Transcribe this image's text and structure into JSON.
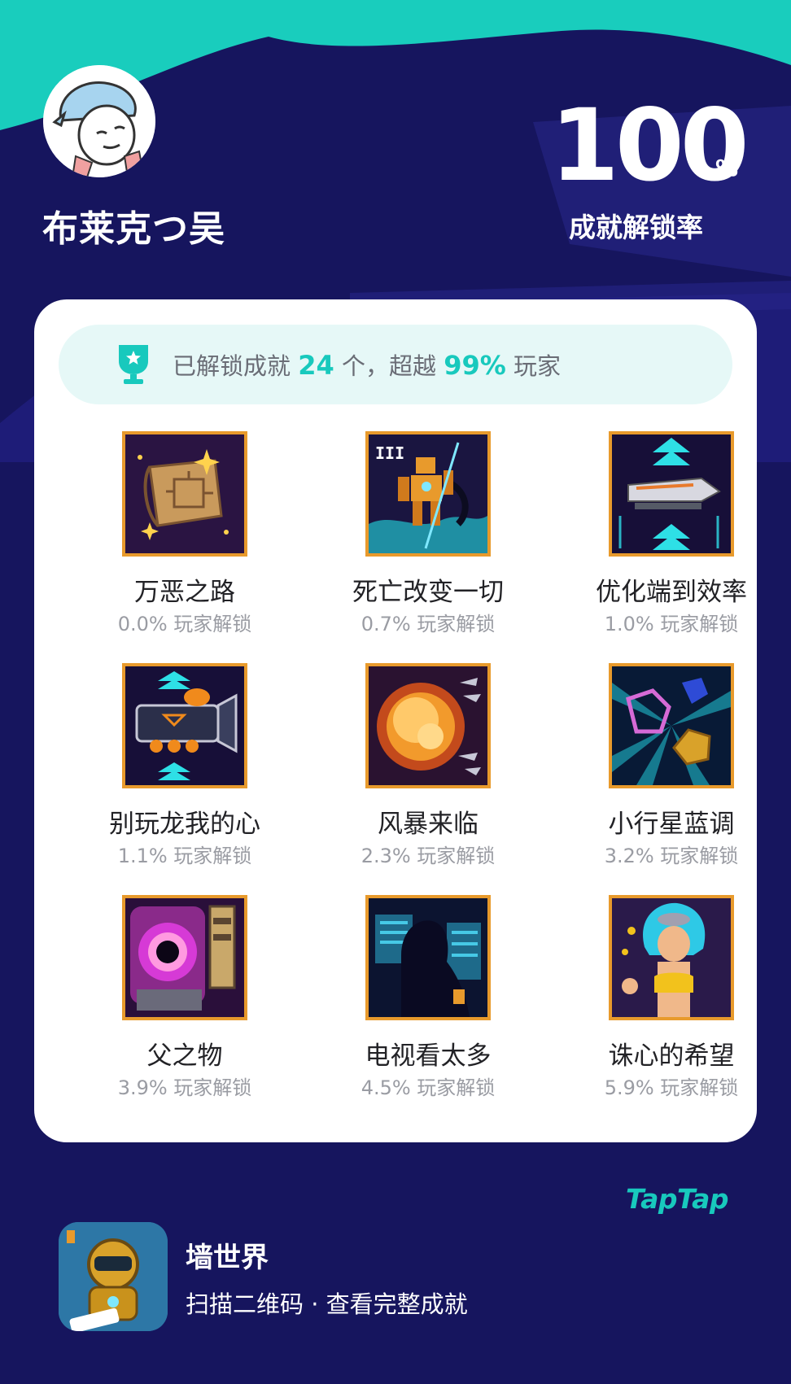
{
  "user": {
    "name": "布莱克つ吴"
  },
  "unlock_rate": {
    "value": "100",
    "unit": "%",
    "label": "成就解锁率"
  },
  "summary": {
    "prefix": "已解锁成就",
    "count": "24",
    "mid": "个，超越",
    "percent": "99%",
    "suffix": "玩家"
  },
  "achievements": [
    {
      "name": "万恶之路",
      "stat": "0.0% 玩家解锁",
      "icon": "treasure-map-icon"
    },
    {
      "name": "死亡改变一切",
      "stat": "0.7% 玩家解锁",
      "icon": "mech-robot-icon"
    },
    {
      "name": "优化端到效率",
      "stat": "1.0% 玩家解锁",
      "icon": "train-upgrade-icon"
    },
    {
      "name": "别玩龙我的心",
      "stat": "1.1% 玩家解锁",
      "icon": "pumpkin-train-icon"
    },
    {
      "name": "风暴来临",
      "stat": "2.3% 玩家解锁",
      "icon": "explosion-icon"
    },
    {
      "name": "小行星蓝调",
      "stat": "3.2% 玩家解锁",
      "icon": "asteroid-gems-icon"
    },
    {
      "name": "父之物",
      "stat": "3.9% 玩家解锁",
      "icon": "portal-vortex-icon"
    },
    {
      "name": "电视看太多",
      "stat": "4.5% 玩家解锁",
      "icon": "tv-silhouette-icon"
    },
    {
      "name": "诛心的希望",
      "stat": "5.9% 玩家解锁",
      "icon": "hero-girl-icon"
    }
  ],
  "brand": {
    "logo_text": "TapTap"
  },
  "game": {
    "title": "墙世界",
    "subtitle": "扫描二维码 · 查看完整成就"
  },
  "colors": {
    "background": "#16155e",
    "accent": "#18c9bd",
    "icon_border": "#e89a2c",
    "card": "#ffffff"
  }
}
